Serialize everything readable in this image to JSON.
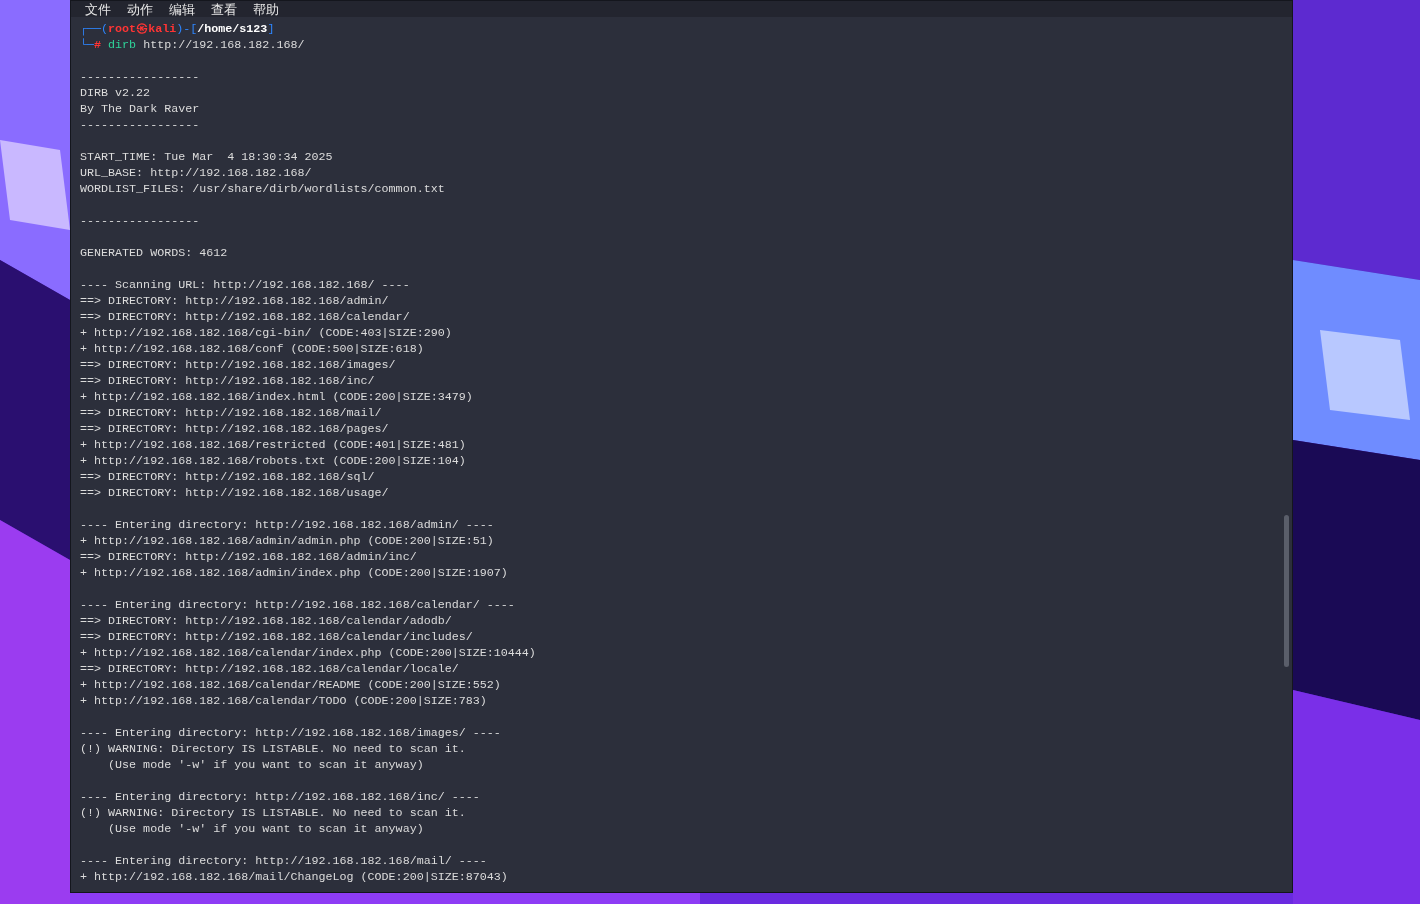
{
  "menu": [
    "文件",
    "动作",
    "编辑",
    "查看",
    "帮助"
  ],
  "prompt": {
    "frame_open": "┌──(",
    "frame_mid": ")-[",
    "frame_close": "]",
    "frame_lower": "└─",
    "user": "root",
    "separator": "㉿",
    "host": "kali",
    "path": "/home/s123",
    "symbol": "#",
    "command": "dirb",
    "argument": "http://192.168.182.168/"
  },
  "lines": [
    {
      "kind": "blank"
    },
    {
      "kind": "text",
      "text": "-----------------"
    },
    {
      "kind": "text",
      "text": "DIRB v2.22"
    },
    {
      "kind": "text",
      "text": "By The Dark Raver"
    },
    {
      "kind": "text",
      "text": "-----------------"
    },
    {
      "kind": "blank"
    },
    {
      "kind": "text",
      "text": "START_TIME: Tue Mar  4 18:30:34 2025"
    },
    {
      "kind": "text",
      "text": "URL_BASE: http://192.168.182.168/"
    },
    {
      "kind": "text",
      "text": "WORDLIST_FILES: /usr/share/dirb/wordlists/common.txt"
    },
    {
      "kind": "blank"
    },
    {
      "kind": "text",
      "text": "-----------------"
    },
    {
      "kind": "blank"
    },
    {
      "kind": "text",
      "text": "GENERATED WORDS: 4612"
    },
    {
      "kind": "blank"
    },
    {
      "kind": "text",
      "text": "---- Scanning URL: http://192.168.182.168/ ----"
    },
    {
      "kind": "text",
      "text": "==> DIRECTORY: http://192.168.182.168/admin/"
    },
    {
      "kind": "text",
      "text": "==> DIRECTORY: http://192.168.182.168/calendar/"
    },
    {
      "kind": "text",
      "text": "+ http://192.168.182.168/cgi-bin/ (CODE:403|SIZE:290)"
    },
    {
      "kind": "text",
      "text": "+ http://192.168.182.168/conf (CODE:500|SIZE:618)"
    },
    {
      "kind": "text",
      "text": "==> DIRECTORY: http://192.168.182.168/images/"
    },
    {
      "kind": "text",
      "text": "==> DIRECTORY: http://192.168.182.168/inc/"
    },
    {
      "kind": "text",
      "text": "+ http://192.168.182.168/index.html (CODE:200|SIZE:3479)"
    },
    {
      "kind": "text",
      "text": "==> DIRECTORY: http://192.168.182.168/mail/"
    },
    {
      "kind": "text",
      "text": "==> DIRECTORY: http://192.168.182.168/pages/"
    },
    {
      "kind": "text",
      "text": "+ http://192.168.182.168/restricted (CODE:401|SIZE:481)"
    },
    {
      "kind": "text",
      "text": "+ http://192.168.182.168/robots.txt (CODE:200|SIZE:104)"
    },
    {
      "kind": "text",
      "text": "==> DIRECTORY: http://192.168.182.168/sql/"
    },
    {
      "kind": "text",
      "text": "==> DIRECTORY: http://192.168.182.168/usage/"
    },
    {
      "kind": "blank"
    },
    {
      "kind": "text",
      "text": "---- Entering directory: http://192.168.182.168/admin/ ----"
    },
    {
      "kind": "text",
      "text": "+ http://192.168.182.168/admin/admin.php (CODE:200|SIZE:51)"
    },
    {
      "kind": "text",
      "text": "==> DIRECTORY: http://192.168.182.168/admin/inc/"
    },
    {
      "kind": "text",
      "text": "+ http://192.168.182.168/admin/index.php (CODE:200|SIZE:1907)"
    },
    {
      "kind": "blank"
    },
    {
      "kind": "text",
      "text": "---- Entering directory: http://192.168.182.168/calendar/ ----"
    },
    {
      "kind": "text",
      "text": "==> DIRECTORY: http://192.168.182.168/calendar/adodb/"
    },
    {
      "kind": "text",
      "text": "==> DIRECTORY: http://192.168.182.168/calendar/includes/"
    },
    {
      "kind": "text",
      "text": "+ http://192.168.182.168/calendar/index.php (CODE:200|SIZE:10444)"
    },
    {
      "kind": "text",
      "text": "==> DIRECTORY: http://192.168.182.168/calendar/locale/"
    },
    {
      "kind": "text",
      "text": "+ http://192.168.182.168/calendar/README (CODE:200|SIZE:552)"
    },
    {
      "kind": "text",
      "text": "+ http://192.168.182.168/calendar/TODO (CODE:200|SIZE:783)"
    },
    {
      "kind": "blank"
    },
    {
      "kind": "text",
      "text": "---- Entering directory: http://192.168.182.168/images/ ----"
    },
    {
      "kind": "text",
      "text": "(!) WARNING: Directory IS LISTABLE. No need to scan it."
    },
    {
      "kind": "text",
      "text": "    (Use mode '-w' if you want to scan it anyway)"
    },
    {
      "kind": "blank"
    },
    {
      "kind": "text",
      "text": "---- Entering directory: http://192.168.182.168/inc/ ----"
    },
    {
      "kind": "text",
      "text": "(!) WARNING: Directory IS LISTABLE. No need to scan it."
    },
    {
      "kind": "text",
      "text": "    (Use mode '-w' if you want to scan it anyway)"
    },
    {
      "kind": "blank"
    },
    {
      "kind": "text",
      "text": "---- Entering directory: http://192.168.182.168/mail/ ----"
    },
    {
      "kind": "text",
      "text": "+ http://192.168.182.168/mail/ChangeLog (CODE:200|SIZE:87043)"
    }
  ]
}
